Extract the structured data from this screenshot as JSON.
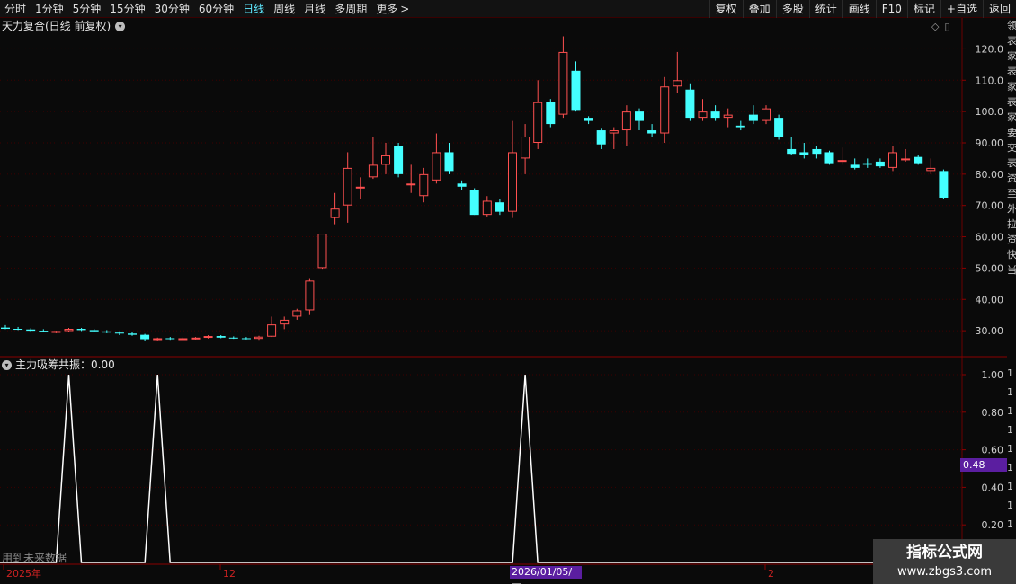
{
  "toolbar": {
    "periods": [
      "分时",
      "1分钟",
      "5分钟",
      "15分钟",
      "30分钟",
      "60分钟",
      "日线",
      "周线",
      "月线",
      "多周期",
      "更多"
    ],
    "active": "日线",
    "more_arrow": ">",
    "right_buttons": [
      "复权",
      "叠加",
      "多股",
      "统计",
      "画线",
      "F10",
      "标记",
      "+自选",
      "返回"
    ]
  },
  "chart": {
    "title": "天力复合(日线 前复权)",
    "y_ticks": [
      "120.0",
      "110.0",
      "100.0",
      "90.00",
      "80.00",
      "70.00",
      "60.00",
      "50.00",
      "40.00",
      "30.00"
    ],
    "up_color": "#ff5050",
    "down_color": "#44ffff"
  },
  "indicator": {
    "title": "主力吸筹共振",
    "value": "0.00",
    "y_ticks": [
      "1.00",
      "0.80",
      "0.60",
      "0.40",
      "0.20"
    ],
    "current_tag": "0.48",
    "peak_x_index": [
      5,
      12,
      41
    ]
  },
  "x_axis": {
    "labels": [
      "2025年",
      "12",
      "2026/01/05/一",
      "2"
    ]
  },
  "future_note": "用到未来数据",
  "right_strip_chars": "领表家表家表家要交表资至外拉资快当",
  "watermark": {
    "line1": "指标公式网",
    "line2": "www.zbgs3.com"
  },
  "chart_data": {
    "type": "candlestick",
    "ylim": [
      22,
      125
    ],
    "candles": [
      {
        "o": 31,
        "h": 31.8,
        "l": 30.5,
        "c": 30.6
      },
      {
        "o": 30.6,
        "h": 31.2,
        "l": 30.2,
        "c": 30.4
      },
      {
        "o": 30.4,
        "h": 30.8,
        "l": 29.8,
        "c": 30.0
      },
      {
        "o": 30.0,
        "h": 30.5,
        "l": 29.5,
        "c": 29.7
      },
      {
        "o": 29.7,
        "h": 30.0,
        "l": 29.2,
        "c": 29.9
      },
      {
        "o": 29.9,
        "h": 30.9,
        "l": 29.6,
        "c": 30.6
      },
      {
        "o": 30.6,
        "h": 30.9,
        "l": 29.9,
        "c": 30.2
      },
      {
        "o": 30.2,
        "h": 30.6,
        "l": 29.6,
        "c": 29.8
      },
      {
        "o": 29.8,
        "h": 30.2,
        "l": 29.2,
        "c": 29.4
      },
      {
        "o": 29.4,
        "h": 29.8,
        "l": 28.6,
        "c": 29.1
      },
      {
        "o": 29.1,
        "h": 29.5,
        "l": 28.4,
        "c": 28.7
      },
      {
        "o": 28.7,
        "h": 29.0,
        "l": 26.8,
        "c": 27.3
      },
      {
        "o": 27.3,
        "h": 27.8,
        "l": 26.9,
        "c": 27.6
      },
      {
        "o": 27.6,
        "h": 28.0,
        "l": 27.1,
        "c": 27.4
      },
      {
        "o": 27.4,
        "h": 27.9,
        "l": 27.0,
        "c": 27.6
      },
      {
        "o": 27.6,
        "h": 28.0,
        "l": 27.2,
        "c": 27.8
      },
      {
        "o": 27.8,
        "h": 28.6,
        "l": 27.5,
        "c": 28.3
      },
      {
        "o": 28.3,
        "h": 28.6,
        "l": 27.6,
        "c": 27.8
      },
      {
        "o": 27.8,
        "h": 28.2,
        "l": 27.4,
        "c": 27.6
      },
      {
        "o": 27.6,
        "h": 28.0,
        "l": 27.2,
        "c": 27.4
      },
      {
        "o": 27.4,
        "h": 28.4,
        "l": 27.1,
        "c": 28.1
      },
      {
        "o": 28.1,
        "h": 34.5,
        "l": 28.0,
        "c": 32.0
      },
      {
        "o": 32.0,
        "h": 34.5,
        "l": 30.5,
        "c": 33.5
      },
      {
        "o": 34.5,
        "h": 37.0,
        "l": 33.5,
        "c": 36.5
      },
      {
        "o": 36.5,
        "h": 46.8,
        "l": 35.0,
        "c": 46.0
      },
      {
        "o": 50.0,
        "h": 61.0,
        "l": 49.8,
        "c": 61.0
      },
      {
        "o": 66.0,
        "h": 74.0,
        "l": 64.0,
        "c": 69.0
      },
      {
        "o": 70.0,
        "h": 87.0,
        "l": 64.5,
        "c": 82.0
      },
      {
        "o": 76.0,
        "h": 79.0,
        "l": 72.0,
        "c": 76.0
      },
      {
        "o": 79.0,
        "h": 92.0,
        "l": 78.5,
        "c": 83.0
      },
      {
        "o": 83.0,
        "h": 90.0,
        "l": 80.0,
        "c": 86.0
      },
      {
        "o": 89.0,
        "h": 90.0,
        "l": 79.0,
        "c": 80.0
      },
      {
        "o": 77.0,
        "h": 83.0,
        "l": 74.0,
        "c": 77.0
      },
      {
        "o": 73.0,
        "h": 82.0,
        "l": 71.0,
        "c": 80.0
      },
      {
        "o": 78.0,
        "h": 93.0,
        "l": 77.0,
        "c": 87.0
      },
      {
        "o": 87.0,
        "h": 90.0,
        "l": 80.0,
        "c": 81.0
      },
      {
        "o": 77.0,
        "h": 78.0,
        "l": 75.0,
        "c": 76.0
      },
      {
        "o": 75.0,
        "h": 75.5,
        "l": 67.0,
        "c": 67.0
      },
      {
        "o": 67.0,
        "h": 73.0,
        "l": 66.5,
        "c": 71.5
      },
      {
        "o": 71.0,
        "h": 72.0,
        "l": 67.0,
        "c": 68.0
      },
      {
        "o": 68.0,
        "h": 97.0,
        "l": 66.0,
        "c": 87.0
      },
      {
        "o": 85.0,
        "h": 96.0,
        "l": 80.0,
        "c": 92.0
      },
      {
        "o": 90.0,
        "h": 110.0,
        "l": 88.0,
        "c": 103.0
      },
      {
        "o": 103.0,
        "h": 104.0,
        "l": 95.0,
        "c": 96.0
      },
      {
        "o": 99.0,
        "h": 124.0,
        "l": 98.0,
        "c": 119.0
      },
      {
        "o": 113.0,
        "h": 116.0,
        "l": 100.0,
        "c": 100.5
      },
      {
        "o": 98.0,
        "h": 98.5,
        "l": 96.0,
        "c": 97.0
      },
      {
        "o": 94.0,
        "h": 94.5,
        "l": 88.0,
        "c": 89.5
      },
      {
        "o": 93.0,
        "h": 95.0,
        "l": 88.0,
        "c": 94.0
      },
      {
        "o": 94.0,
        "h": 102.0,
        "l": 89.0,
        "c": 100.0
      },
      {
        "o": 100.0,
        "h": 101.0,
        "l": 94.0,
        "c": 97.0
      },
      {
        "o": 94.0,
        "h": 96.0,
        "l": 92.0,
        "c": 93.0
      },
      {
        "o": 93.0,
        "h": 111.0,
        "l": 90.0,
        "c": 108.0
      },
      {
        "o": 108.0,
        "h": 119.0,
        "l": 106.0,
        "c": 110.0
      },
      {
        "o": 107.0,
        "h": 109.0,
        "l": 97.0,
        "c": 98.0
      },
      {
        "o": 98.0,
        "h": 104.0,
        "l": 97.0,
        "c": 100.0
      },
      {
        "o": 100.0,
        "h": 102.0,
        "l": 97.0,
        "c": 98.0
      },
      {
        "o": 98.0,
        "h": 101.0,
        "l": 95.0,
        "c": 99.0
      },
      {
        "o": 95.5,
        "h": 97.0,
        "l": 94.0,
        "c": 95.0
      },
      {
        "o": 99.0,
        "h": 102.0,
        "l": 96.0,
        "c": 97.0
      },
      {
        "o": 97.0,
        "h": 102.0,
        "l": 96.0,
        "c": 101.0
      },
      {
        "o": 98.0,
        "h": 99.0,
        "l": 91.0,
        "c": 92.0
      },
      {
        "o": 88.0,
        "h": 92.0,
        "l": 86.0,
        "c": 86.5
      },
      {
        "o": 87.0,
        "h": 90.0,
        "l": 85.0,
        "c": 86.0
      },
      {
        "o": 88.0,
        "h": 89.0,
        "l": 85.0,
        "c": 86.5
      },
      {
        "o": 87.0,
        "h": 87.5,
        "l": 83.0,
        "c": 83.5
      },
      {
        "o": 84.0,
        "h": 88.5,
        "l": 83.0,
        "c": 84.5
      },
      {
        "o": 83.0,
        "h": 85.0,
        "l": 81.5,
        "c": 82.0
      },
      {
        "o": 83.5,
        "h": 85.0,
        "l": 82.0,
        "c": 83.0
      },
      {
        "o": 84.0,
        "h": 85.0,
        "l": 82.0,
        "c": 82.5
      },
      {
        "o": 82.0,
        "h": 89.0,
        "l": 81.0,
        "c": 87.0
      },
      {
        "o": 85.0,
        "h": 88.0,
        "l": 84.0,
        "c": 85.0
      },
      {
        "o": 85.5,
        "h": 86.0,
        "l": 83.0,
        "c": 83.5
      },
      {
        "o": 81.0,
        "h": 85.0,
        "l": 80.0,
        "c": 82.0
      },
      {
        "o": 81.0,
        "h": 81.5,
        "l": 72.0,
        "c": 72.5
      }
    ]
  }
}
